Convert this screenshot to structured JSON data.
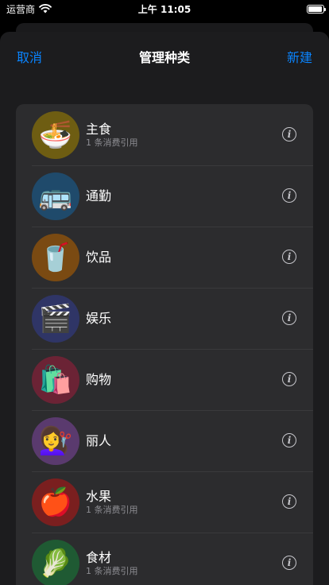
{
  "status_bar": {
    "carrier": "运营商",
    "time": "上午 11:05",
    "battery_level": 0.95
  },
  "nav": {
    "cancel_label": "取消",
    "title": "管理种类",
    "new_label": "新建"
  },
  "info_glyph": "i",
  "categories": [
    {
      "name": "主食",
      "subtitle": "1 条消费引用",
      "emoji": "🍜",
      "color": "#6e5d12"
    },
    {
      "name": "通勤",
      "subtitle": "",
      "emoji": "🚌",
      "color": "#1f4a6b"
    },
    {
      "name": "饮品",
      "subtitle": "",
      "emoji": "🥤",
      "color": "#7a4a12"
    },
    {
      "name": "娱乐",
      "subtitle": "",
      "emoji": "🎬",
      "color": "#2f3566"
    },
    {
      "name": "购物",
      "subtitle": "",
      "emoji": "🛍️",
      "color": "#6b2335"
    },
    {
      "name": "丽人",
      "subtitle": "",
      "emoji": "💇‍♀️",
      "color": "#5a3a6e"
    },
    {
      "name": "水果",
      "subtitle": "1 条消费引用",
      "emoji": "🍎",
      "color": "#7a1f1f"
    },
    {
      "name": "食材",
      "subtitle": "1 条消费引用",
      "emoji": "🥬",
      "color": "#1f5a33"
    }
  ]
}
